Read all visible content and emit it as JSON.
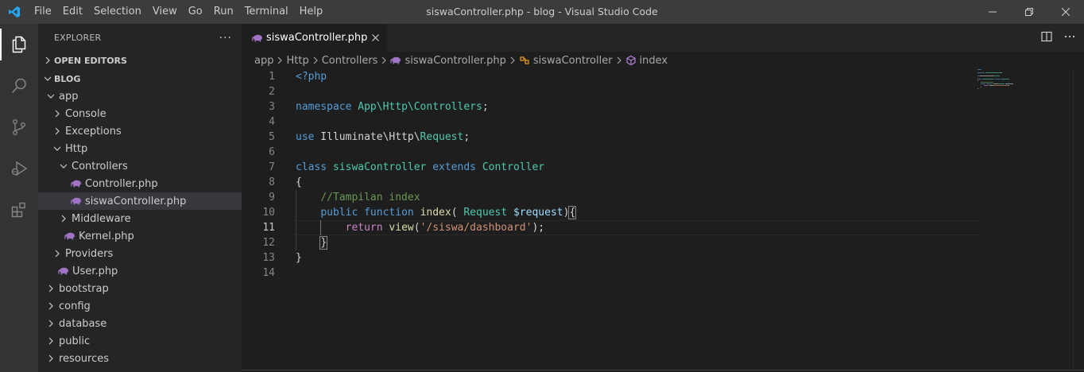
{
  "window": {
    "title": "siswaController.php - blog - Visual Studio Code",
    "menu": [
      "File",
      "Edit",
      "Selection",
      "View",
      "Go",
      "Run",
      "Terminal",
      "Help"
    ]
  },
  "activity_bar": [
    "explorer-icon",
    "search-icon",
    "source-control-icon",
    "run-debug-icon",
    "extensions-icon"
  ],
  "sidebar": {
    "title": "EXPLORER",
    "more": "···",
    "open_editors": "OPEN EDITORS",
    "project": "BLOG",
    "tree": [
      {
        "label": "app",
        "depth": 1,
        "type": "folder",
        "open": true
      },
      {
        "label": "Console",
        "depth": 2,
        "type": "folder",
        "open": false
      },
      {
        "label": "Exceptions",
        "depth": 2,
        "type": "folder",
        "open": false
      },
      {
        "label": "Http",
        "depth": 2,
        "type": "folder",
        "open": true
      },
      {
        "label": "Controllers",
        "depth": 3,
        "type": "folder",
        "open": true
      },
      {
        "label": "Controller.php",
        "depth": 4,
        "type": "php"
      },
      {
        "label": "siswaController.php",
        "depth": 4,
        "type": "php",
        "selected": true
      },
      {
        "label": "Middleware",
        "depth": 3,
        "type": "folder",
        "open": false
      },
      {
        "label": "Kernel.php",
        "depth": 3,
        "type": "php"
      },
      {
        "label": "Providers",
        "depth": 2,
        "type": "folder",
        "open": false
      },
      {
        "label": "User.php",
        "depth": 2,
        "type": "php"
      },
      {
        "label": "bootstrap",
        "depth": 1,
        "type": "folder",
        "open": false
      },
      {
        "label": "config",
        "depth": 1,
        "type": "folder",
        "open": false
      },
      {
        "label": "database",
        "depth": 1,
        "type": "folder",
        "open": false
      },
      {
        "label": "public",
        "depth": 1,
        "type": "folder",
        "open": false
      },
      {
        "label": "resources",
        "depth": 1,
        "type": "folder",
        "open": false
      }
    ]
  },
  "editor": {
    "tab_label": "siswaController.php",
    "breadcrumb": {
      "app": "app",
      "http": "Http",
      "controllers": "Controllers",
      "file": "siswaController.php",
      "class": "siswaController",
      "method": "index"
    },
    "current_line": 11,
    "lines": [
      [
        {
          "t": "<?php",
          "c": "kw"
        }
      ],
      [],
      [
        {
          "t": "namespace",
          "c": "kw"
        },
        {
          "t": " ",
          "c": "pl"
        },
        {
          "t": "App\\Http\\Controllers",
          "c": "ty"
        },
        {
          "t": ";",
          "c": "pl"
        }
      ],
      [],
      [
        {
          "t": "use",
          "c": "kw"
        },
        {
          "t": " Illuminate\\Http\\",
          "c": "pl"
        },
        {
          "t": "Request",
          "c": "ty"
        },
        {
          "t": ";",
          "c": "pl"
        }
      ],
      [],
      [
        {
          "t": "class",
          "c": "kw"
        },
        {
          "t": " ",
          "c": "pl"
        },
        {
          "t": "siswaController",
          "c": "ty"
        },
        {
          "t": " ",
          "c": "pl"
        },
        {
          "t": "extends",
          "c": "kw"
        },
        {
          "t": " ",
          "c": "pl"
        },
        {
          "t": "Controller",
          "c": "ty"
        }
      ],
      [
        {
          "t": "{",
          "c": "pl"
        }
      ],
      [
        {
          "t": "    ",
          "c": "pl"
        },
        {
          "t": "//Tampilan index",
          "c": "cm"
        }
      ],
      [
        {
          "t": "    ",
          "c": "pl"
        },
        {
          "t": "public",
          "c": "kw"
        },
        {
          "t": " ",
          "c": "pl"
        },
        {
          "t": "function",
          "c": "kw"
        },
        {
          "t": " ",
          "c": "pl"
        },
        {
          "t": "index",
          "c": "fn"
        },
        {
          "t": "( ",
          "c": "pl"
        },
        {
          "t": "Request",
          "c": "ty"
        },
        {
          "t": " ",
          "c": "pl"
        },
        {
          "t": "$request",
          "c": "var"
        },
        {
          "t": ")",
          "c": "pl"
        },
        {
          "t": "{",
          "c": "pl bracket-match"
        }
      ],
      [
        {
          "t": "        ",
          "c": "pl"
        },
        {
          "t": "return",
          "c": "ctl"
        },
        {
          "t": " ",
          "c": "pl"
        },
        {
          "t": "view",
          "c": "fn"
        },
        {
          "t": "(",
          "c": "pl"
        },
        {
          "t": "'/siswa/dashboard'",
          "c": "str"
        },
        {
          "t": ");",
          "c": "pl"
        }
      ],
      [
        {
          "t": "    ",
          "c": "pl"
        },
        {
          "t": "}",
          "c": "pl bracket-match"
        }
      ],
      [
        {
          "t": "}",
          "c": "pl"
        }
      ],
      []
    ]
  },
  "colors": {
    "accent": "#007acc",
    "php_icon": "#a074c4"
  }
}
